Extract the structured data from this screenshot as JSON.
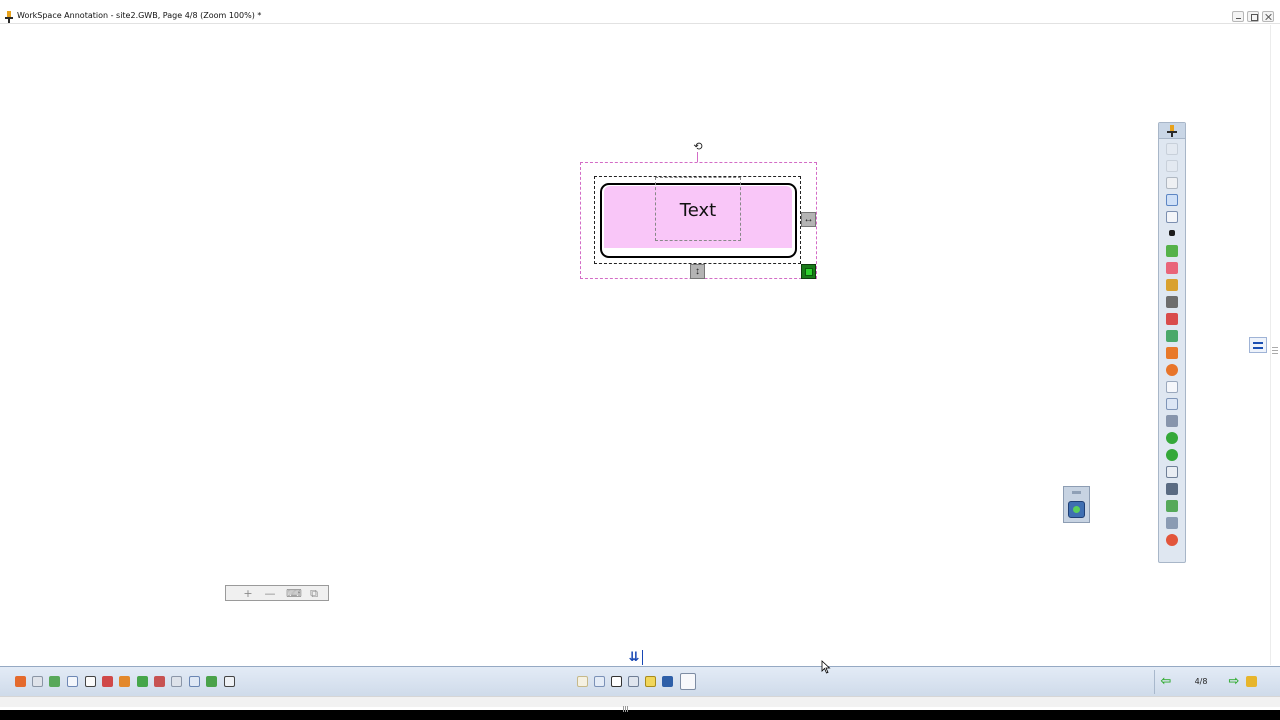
{
  "window": {
    "title": "WorkSpace Annotation - site2.GWB, Page 4/8  (Zoom 100%) *"
  },
  "canvas": {
    "shape_text": "Text",
    "shape_fill_color": "#f9c6f8",
    "selection_color": "#d36cc6"
  },
  "handles": {
    "rotate_glyph": "⟲",
    "horizontal_glyph": "↔",
    "vertical_glyph": "↕"
  },
  "right_toolbar": {
    "icons": [
      "workspace-logo-icon",
      "undo-icon",
      "redo-icon",
      "hand-icon",
      "page-icon",
      "select-arrow-icon",
      "pen-icon",
      "highlighter-icon",
      "eraser-icon",
      "fill-icon",
      "line-icon",
      "text-icon",
      "shapes-icon",
      "gallery-icon",
      "delete-icon",
      "blank-page-icon",
      "page-sorter-icon",
      "screen-capture-icon",
      "previous-page-icon",
      "next-page-icon",
      "table-icon",
      "print-icon",
      "lock-icon",
      "tools-icon",
      "exit-icon"
    ]
  },
  "mini_toolbar": {
    "buttons": [
      "+",
      "—",
      "⌨",
      "⧉"
    ]
  },
  "page_flip": {
    "glyph": "⇊"
  },
  "bottom_toolbar": {
    "page_indicator": "4/8",
    "prev_glyph": "⇦",
    "next_glyph": "⇨"
  }
}
